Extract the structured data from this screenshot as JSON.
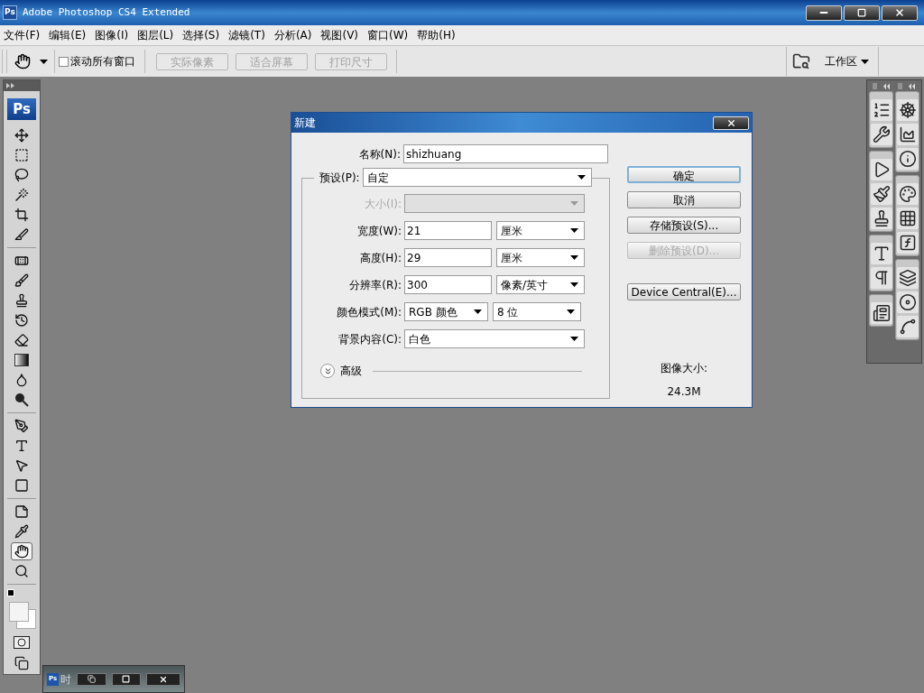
{
  "window": {
    "logo": "Ps",
    "title": "Adobe Photoshop CS4 Extended"
  },
  "menu": [
    "文件(F)",
    "编辑(E)",
    "图像(I)",
    "图层(L)",
    "选择(S)",
    "滤镜(T)",
    "分析(A)",
    "视图(V)",
    "窗口(W)",
    "帮助(H)"
  ],
  "options_bar": {
    "scroll_all": {
      "label": "滚动所有窗口",
      "checked": false
    },
    "buttons": [
      {
        "label": "实际像素",
        "disabled": true
      },
      {
        "label": "适合屏幕",
        "disabled": true
      },
      {
        "label": "打印尺寸",
        "disabled": true
      }
    ],
    "workspace": "工作区"
  },
  "toolbox": {
    "logo": "Ps",
    "tools": [
      {
        "kind": "move",
        "selected": false
      },
      {
        "kind": "marquee",
        "selected": false
      },
      {
        "kind": "lasso",
        "selected": false
      },
      {
        "kind": "wand",
        "selected": false
      },
      {
        "kind": "crop",
        "selected": false
      },
      {
        "kind": "slice",
        "selected": false
      },
      {
        "kind": "heal",
        "selected": false
      },
      {
        "kind": "brush",
        "selected": false
      },
      {
        "kind": "stamp",
        "selected": false
      },
      {
        "kind": "history",
        "selected": false
      },
      {
        "kind": "eraser",
        "selected": false
      },
      {
        "kind": "gradient",
        "selected": false
      },
      {
        "kind": "blur",
        "selected": false
      },
      {
        "kind": "dodge",
        "selected": false
      },
      {
        "kind": "pen",
        "selected": false
      },
      {
        "kind": "type",
        "selected": false
      },
      {
        "kind": "select",
        "selected": false
      },
      {
        "kind": "shape",
        "selected": false
      },
      {
        "kind": "notes",
        "selected": false
      },
      {
        "kind": "eyedropper",
        "selected": false
      },
      {
        "kind": "hand",
        "selected": true
      },
      {
        "kind": "zoom",
        "selected": false
      }
    ]
  },
  "dialog": {
    "title": "新建",
    "name": {
      "label": "名称(N):",
      "value": "shizhuang"
    },
    "preset": {
      "label": "预设(P):",
      "value": "自定"
    },
    "fields": [
      {
        "kind": "select",
        "label": "大小(I):",
        "disabled": true
      },
      {
        "kind": "measure",
        "label": "宽度(W):",
        "value": "21",
        "unit": "厘米",
        "disabled": false
      },
      {
        "kind": "measure",
        "label": "高度(H):",
        "value": "29",
        "unit": "厘米",
        "disabled": false
      },
      {
        "kind": "measure",
        "label": "分辨率(R):",
        "value": "300",
        "unit": "像素/英寸",
        "disabled": false
      },
      {
        "kind": "mode",
        "label": "颜色模式(M):",
        "value": "RGB 颜色",
        "unit": "8 位",
        "disabled": false
      },
      {
        "kind": "select",
        "label": "背景内容(C):",
        "value": "白色",
        "disabled": false
      }
    ],
    "advanced": {
      "label": "高级",
      "expanded": false
    },
    "buttons": [
      {
        "label": "确定",
        "default": true,
        "disabled": false
      },
      {
        "label": "取消",
        "default": false,
        "disabled": false
      },
      {
        "label": "存储预设(S)...",
        "default": false,
        "disabled": false
      },
      {
        "label": "删除预设(D)...",
        "default": false,
        "disabled": true
      },
      {
        "label": "Device Central(E)...",
        "default": false,
        "disabled": false
      }
    ],
    "image_size": {
      "label": "图像大小:",
      "value": "24.3M"
    }
  },
  "minimized_document": {
    "logo": "Ps",
    "title": "时"
  }
}
